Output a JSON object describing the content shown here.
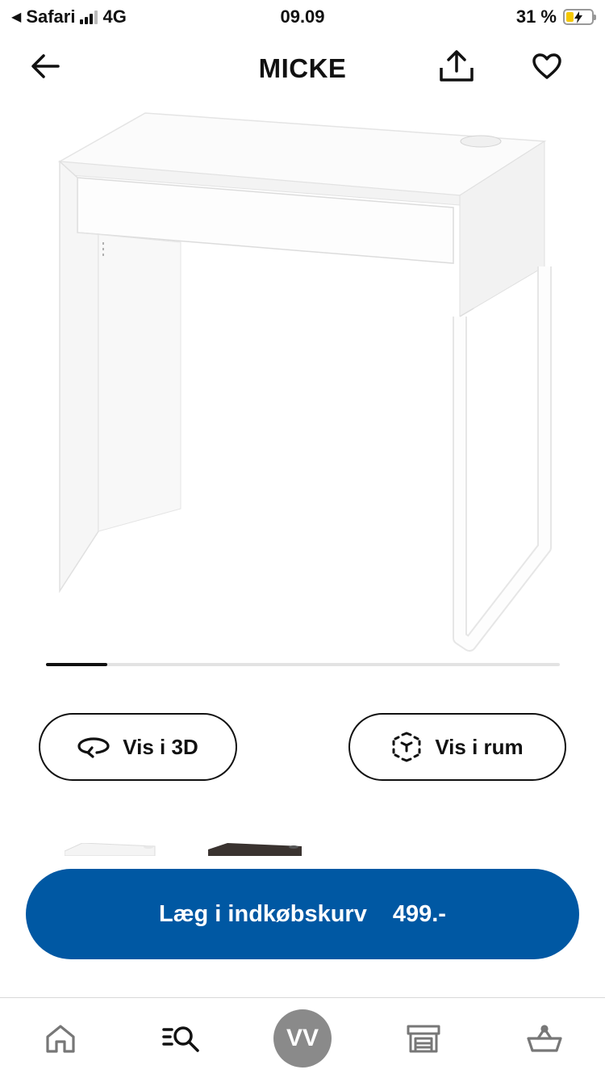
{
  "status_bar": {
    "back_app": "Safari",
    "network": "4G",
    "time": "09.09",
    "battery_percent": "31 %",
    "battery_level": 0.31
  },
  "header": {
    "title": "MICKE"
  },
  "carousel": {
    "position": 0.12
  },
  "actions": {
    "view_3d": "Vis i 3D",
    "view_room": "Vis i rum"
  },
  "variants": [
    {
      "color": "#ffffff"
    },
    {
      "color": "#3a3330"
    }
  ],
  "cta": {
    "label": "Læg i indkøbskurv",
    "price": "499.-",
    "color": "#0058a3"
  },
  "tabbar": {
    "items": [
      {
        "icon": "home-icon"
      },
      {
        "icon": "search-list-icon"
      },
      {
        "icon": "avatar",
        "initials": "VV"
      },
      {
        "icon": "store-icon"
      },
      {
        "icon": "basket-icon"
      }
    ]
  }
}
